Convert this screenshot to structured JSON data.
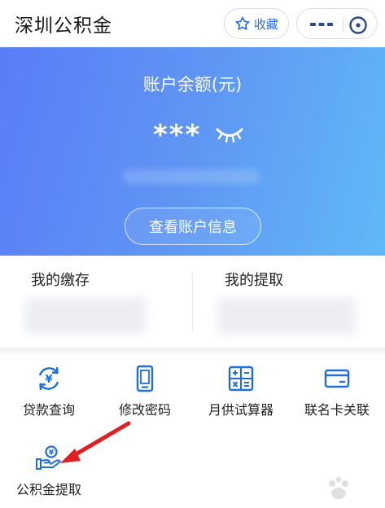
{
  "header": {
    "title": "深圳公积金",
    "favorite_label": "收藏",
    "favorite_icon": "star-icon",
    "more_icon": "more-dots-icon",
    "close_icon": "close-circle-icon"
  },
  "balance": {
    "label": "账户余额(元)",
    "value": "***",
    "visibility_icon": "eye-closed-icon",
    "button_label": "查看账户信息"
  },
  "summary": {
    "deposit_label": "我的缴存",
    "withdraw_label": "我的提取"
  },
  "services": [
    {
      "label": "贷款查询",
      "icon": "loan-exchange-icon"
    },
    {
      "label": "修改密码",
      "icon": "phone-icon"
    },
    {
      "label": "月供试算器",
      "icon": "calculator-icon"
    },
    {
      "label": "联名卡关联",
      "icon": "card-icon"
    },
    {
      "label": "公积金提取",
      "icon": "hand-coin-icon"
    }
  ],
  "colors": {
    "accent": "#2e6cf0",
    "banner_start": "#5a7cf6",
    "banner_end": "#60b9f6",
    "annotation": "#e02020"
  }
}
